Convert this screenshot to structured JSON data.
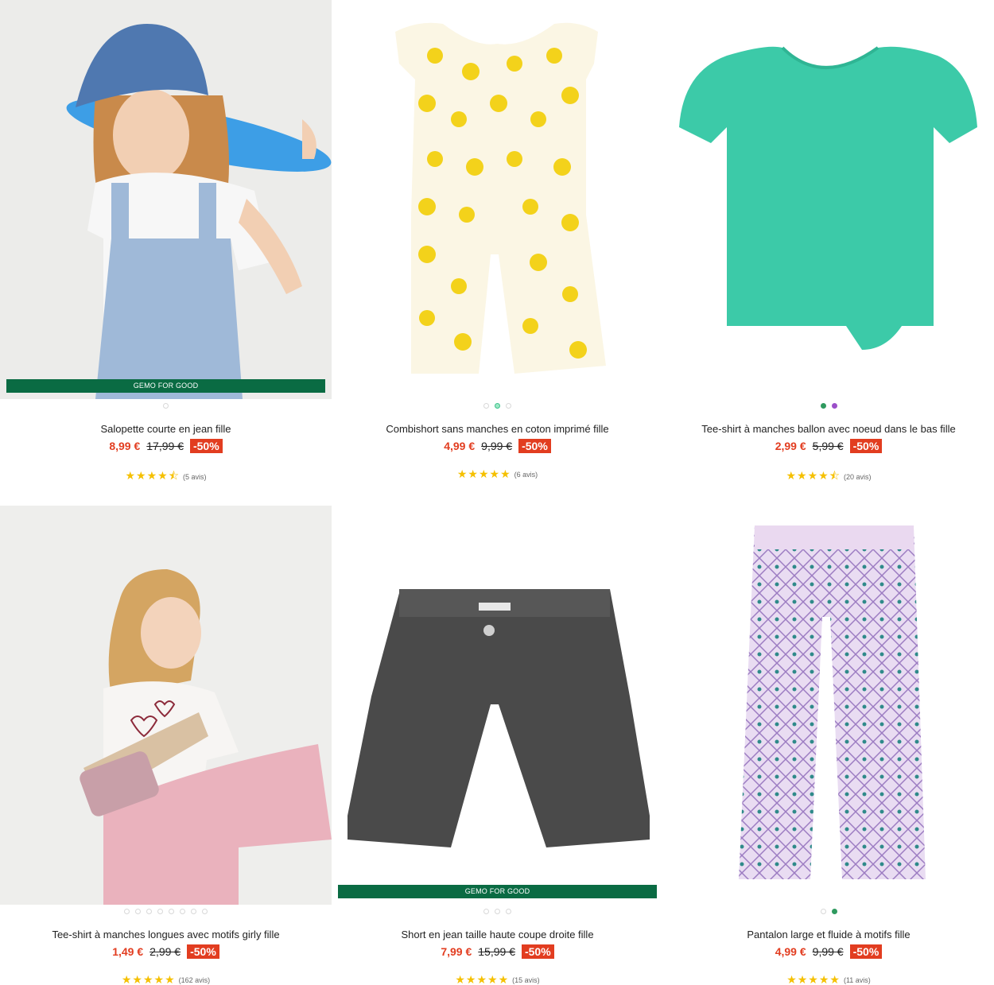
{
  "products": [
    {
      "title": "Salopette courte en jean fille",
      "price": "8,99 €",
      "old_price": "17,99 €",
      "discount": "-50%",
      "stars": "★★★★⯪",
      "reviews": "(5 avis)",
      "badge": "GEMO FOR GOOD",
      "image_icon": "girl-with-skateboard-photo"
    },
    {
      "title": "Combishort sans manches en coton imprimé fille",
      "price": "4,99 €",
      "old_price": "9,99 €",
      "discount": "-50%",
      "stars": "★★★★★",
      "reviews": "(6 avis)",
      "image_icon": "lemon-print-playsuit-photo"
    },
    {
      "title": "Tee-shirt à manches ballon avec noeud dans le bas fille",
      "price": "2,99 €",
      "old_price": "5,99 €",
      "discount": "-50%",
      "stars": "★★★★⯪",
      "reviews": "(20 avis)",
      "image_icon": "turquoise-tshirt-photo"
    },
    {
      "title": "Tee-shirt à manches longues avec motifs girly fille",
      "price": "1,49 €",
      "old_price": "2,99 €",
      "discount": "-50%",
      "stars": "★★★★★",
      "reviews": "(162 avis)",
      "image_icon": "girl-with-guitar-photo"
    },
    {
      "title": "Short en jean taille haute coupe droite fille",
      "price": "7,99 €",
      "old_price": "15,99 €",
      "discount": "-50%",
      "stars": "★★★★★",
      "reviews": "(15 avis)",
      "badge": "GEMO FOR GOOD",
      "image_icon": "denim-shorts-photo"
    },
    {
      "title": "Pantalon large et fluide à motifs fille",
      "price": "4,99 €",
      "old_price": "9,99 €",
      "discount": "-50%",
      "stars": "★★★★★",
      "reviews": "(11 avis)",
      "image_icon": "printed-trousers-photo"
    }
  ],
  "colors": {
    "price_red": "#e23d20",
    "badge_green": "#0a6b43",
    "star_yellow": "#f5c000"
  }
}
